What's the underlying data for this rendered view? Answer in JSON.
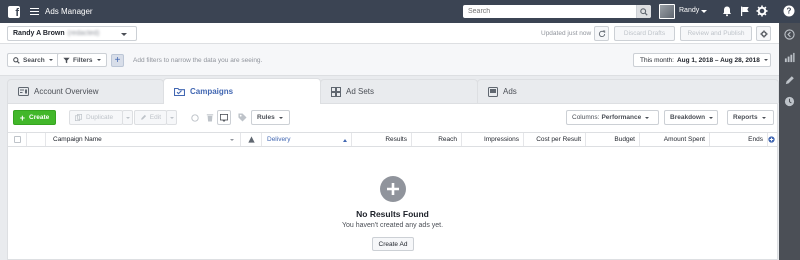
{
  "topbar": {
    "app_title": "Ads Manager",
    "search_placeholder": "Search",
    "user_name": "Randy",
    "icons": [
      "facebook-logo",
      "menu-icon",
      "search-icon",
      "bell-icon",
      "flag-icon",
      "gear-icon",
      "help-icon"
    ]
  },
  "rail": {
    "icons": [
      "collapse-icon",
      "chart-icon",
      "edit-icon",
      "clock-icon"
    ]
  },
  "header": {
    "account_name": "Randy A Brown",
    "account_id": "(redacted)",
    "updated_text": "Updated just now",
    "discard_label": "Discard Drafts",
    "review_label": "Review and Publish"
  },
  "filters": {
    "search_label": "Search",
    "filters_label": "Filters",
    "hint": "Add filters to narrow the data you are seeing.",
    "date_prefix": "This month:",
    "date_range": "Aug 1, 2018 – Aug 28, 2018"
  },
  "tabs": [
    {
      "label": "Account Overview",
      "active": false
    },
    {
      "label": "Campaigns",
      "active": true
    },
    {
      "label": "Ad Sets",
      "active": false
    },
    {
      "label": "Ads",
      "active": false
    }
  ],
  "toolbar": {
    "create_label": "Create",
    "duplicate_label": "Duplicate",
    "edit_label": "Edit",
    "rules_label": "Rules",
    "columns_prefix": "Columns:",
    "columns_value": "Performance",
    "breakdown_label": "Breakdown",
    "reports_label": "Reports"
  },
  "table": {
    "columns": [
      "Campaign Name",
      "Delivery",
      "Results",
      "Reach",
      "Impressions",
      "Cost per Result",
      "Budget",
      "Amount Spent",
      "Ends"
    ],
    "sorted_column": "Delivery",
    "accent_color": "#4267b2"
  },
  "empty_state": {
    "title": "No Results Found",
    "subtitle": "You haven't created any ads yet.",
    "button_label": "Create Ad"
  },
  "colors": {
    "topbar": "#3b4453",
    "accent": "#4267b2",
    "create": "#42b72a"
  }
}
